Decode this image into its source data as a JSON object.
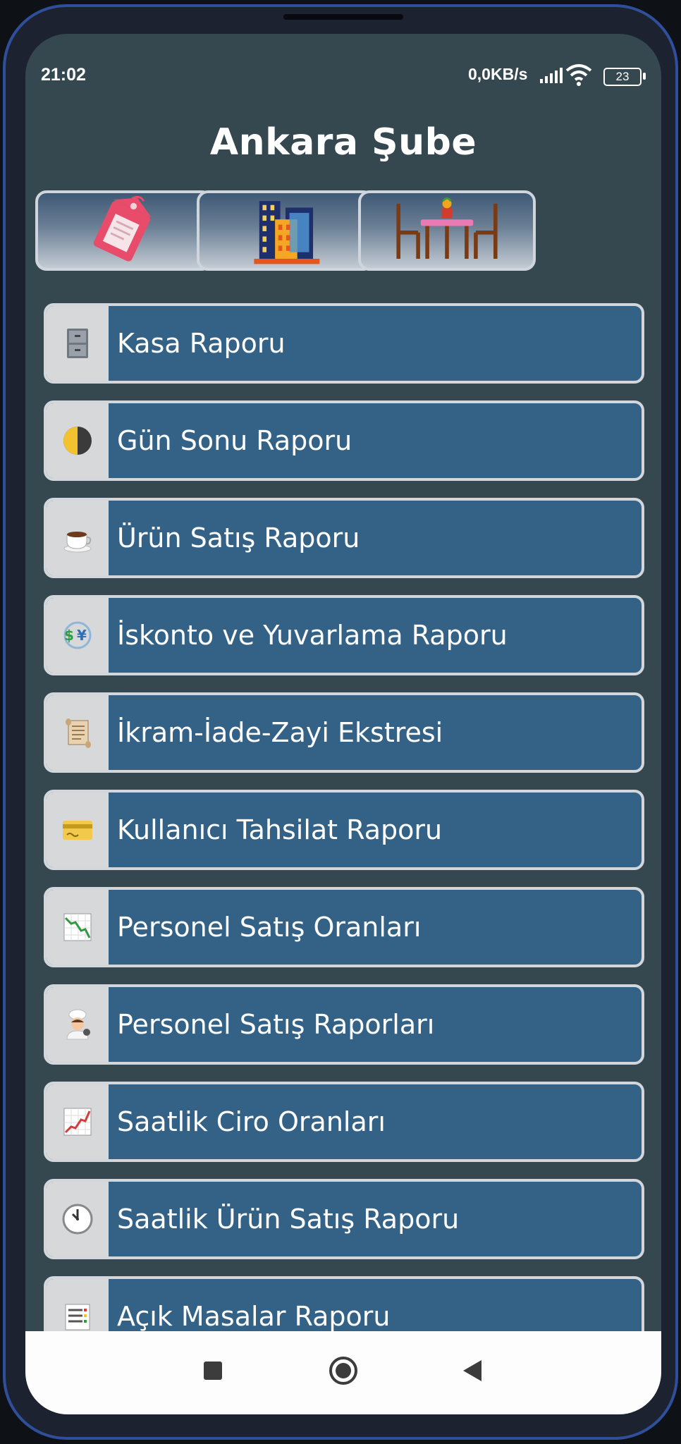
{
  "status_bar": {
    "time": "21:02",
    "network_speed": "0,0KB/s",
    "battery_level": "23"
  },
  "header": {
    "title": "Ankara Şube"
  },
  "quick_buttons": [
    {
      "icon": "price-tag-icon"
    },
    {
      "icon": "buildings-icon"
    },
    {
      "icon": "dining-table-icon"
    }
  ],
  "menu": {
    "items": [
      {
        "label": "Kasa Raporu",
        "icon": "file-cabinet-icon"
      },
      {
        "label": "Gün Sonu Raporu",
        "icon": "half-moon-icon"
      },
      {
        "label": "Ürün Satış Raporu",
        "icon": "coffee-cup-icon"
      },
      {
        "label": "İskonto ve Yuvarlama Raporu",
        "icon": "currency-exchange-icon"
      },
      {
        "label": "İkram-İade-Zayi Ekstresi",
        "icon": "scroll-icon"
      },
      {
        "label": "Kullanıcı Tahsilat Raporu",
        "icon": "credit-card-icon"
      },
      {
        "label": "Personel Satış Oranları",
        "icon": "chart-decreasing-icon"
      },
      {
        "label": "Personel Satış Raporları",
        "icon": "cook-icon"
      },
      {
        "label": "Saatlik Ciro Oranları",
        "icon": "chart-increasing-icon"
      },
      {
        "label": "Saatlik Ürün Satış Raporu",
        "icon": "clock-icon"
      },
      {
        "label": "Açık Masalar Raporu",
        "icon": "list-icon"
      }
    ]
  },
  "colors": {
    "background": "#35474f",
    "menu_item": "#346286",
    "menu_border": "#d3d7dc",
    "icon_box": "#d7d8da"
  },
  "nav_bar": {
    "buttons": [
      "recent-apps",
      "home",
      "back"
    ]
  }
}
